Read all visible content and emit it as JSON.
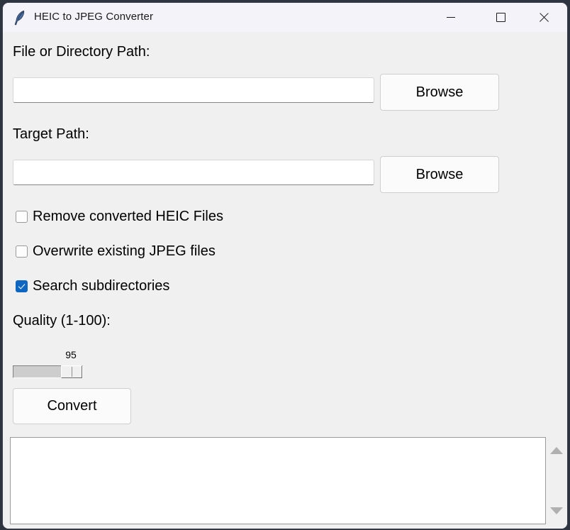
{
  "window": {
    "title": "HEIC to JPEG Converter",
    "icon": "feather-icon",
    "controls": {
      "minimize": "minimize-icon",
      "maximize": "maximize-icon",
      "close": "close-icon"
    },
    "accent_color": "#0d66c2",
    "titlebar_color": "#f3f3f9",
    "body_color": "#f0f0f0"
  },
  "form": {
    "source_label": "File or Directory Path:",
    "source_value": "",
    "source_placeholder": "",
    "source_browse_label": "Browse",
    "target_label": "Target Path:",
    "target_value": "",
    "target_placeholder": "",
    "target_browse_label": "Browse"
  },
  "options": [
    {
      "label": "Remove converted HEIC Files",
      "checked": false
    },
    {
      "label": "Overwrite existing JPEG files",
      "checked": false
    },
    {
      "label": "Search subdirectories",
      "checked": true
    }
  ],
  "quality": {
    "label": "Quality (1-100):",
    "value": "95",
    "min": 1,
    "max": 100
  },
  "actions": {
    "convert_label": "Convert"
  },
  "log": {
    "text": "",
    "scrollbar_up": "scroll-up-arrow",
    "scrollbar_down": "scroll-down-arrow"
  }
}
